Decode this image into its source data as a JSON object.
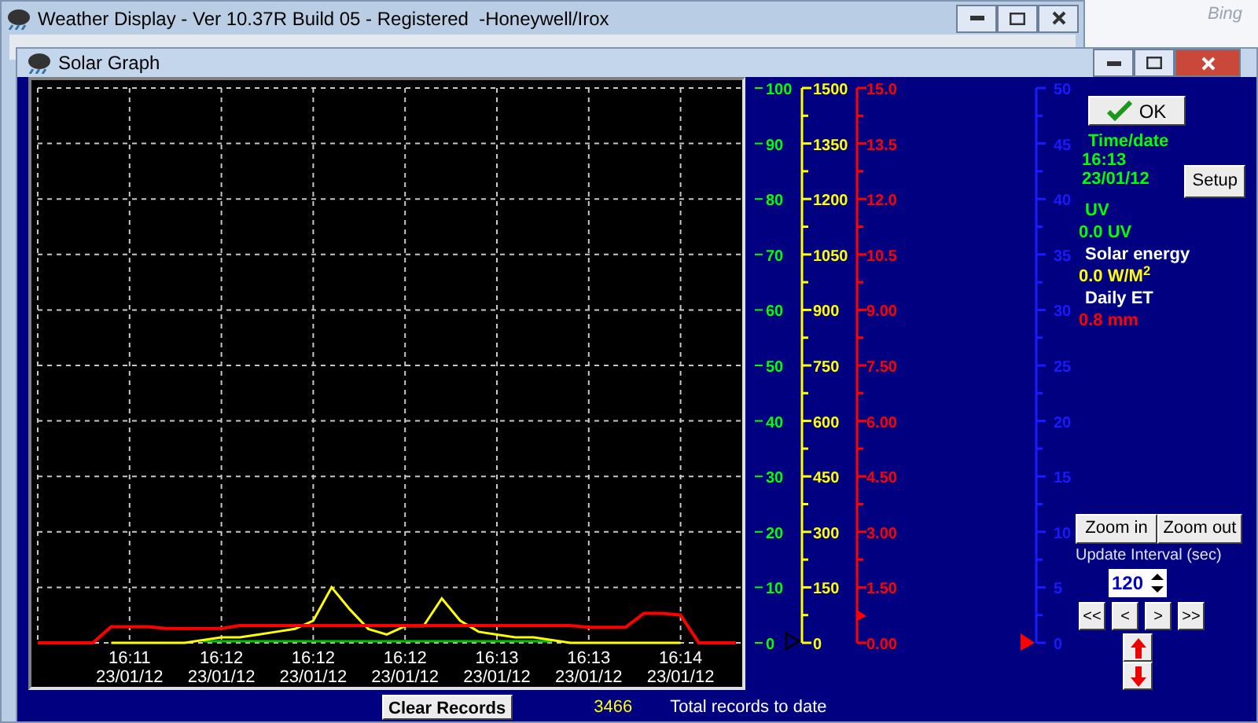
{
  "main_window": {
    "title": "Weather Display - Ver 10.37R Build 05 - Registered  -Honeywell/Irox"
  },
  "browser_behind": {
    "text": "Bing"
  },
  "solar_window": {
    "title": "Solar Graph"
  },
  "chart_data": {
    "type": "line",
    "categories": [
      null,
      null,
      null,
      null,
      null,
      "16:11\n23/01/12",
      null,
      null,
      null,
      null,
      "16:12\n23/01/12",
      null,
      null,
      null,
      null,
      "16:12\n23/01/12",
      null,
      null,
      null,
      null,
      "16:12\n23/01/12",
      null,
      null,
      null,
      null,
      "16:13\n23/01/12",
      null,
      null,
      null,
      null,
      "16:13\n23/01/12",
      null,
      null,
      null,
      null,
      "16:14\n23/01/12",
      null,
      null,
      null
    ],
    "series": [
      {
        "color": "#ff0000",
        "values": [
          0,
          0,
          0,
          0,
          2.9,
          2.9,
          2.9,
          2.6,
          2.6,
          2.6,
          2.6,
          3.1,
          3.1,
          3.1,
          3.1,
          3.1,
          3.1,
          3.1,
          3.1,
          3.1,
          3.1,
          3.1,
          3.1,
          3.1,
          3.1,
          3.1,
          3.1,
          3.1,
          3.1,
          3.1,
          2.8,
          2.8,
          2.8,
          5.3,
          5.3,
          5,
          0,
          0,
          0
        ]
      },
      {
        "color": "#ffff00",
        "values": [
          null,
          null,
          null,
          null,
          0,
          0,
          0,
          0,
          0,
          0.5,
          1,
          1,
          1.5,
          2,
          2.5,
          4,
          10,
          6,
          2.5,
          1.5,
          3,
          3,
          8,
          4,
          2,
          1.5,
          1,
          1,
          0.5,
          0,
          0,
          0,
          0,
          0,
          0,
          0,
          null,
          null,
          null
        ]
      },
      {
        "color": "#00c000",
        "values": [
          null,
          null,
          null,
          null,
          null,
          null,
          null,
          null,
          null,
          0.3,
          0.3,
          0.3,
          0.3,
          0.3,
          0.3,
          0.3,
          0.3,
          0.3,
          0.3,
          0.3,
          0.3,
          0.3,
          0.3,
          0.3,
          0.3,
          0.3,
          0.3,
          0.3,
          0.3,
          null,
          null,
          null,
          null,
          null,
          null,
          null,
          null,
          null,
          null
        ]
      }
    ],
    "ylim": [
      0,
      100
    ],
    "grid": true,
    "yticks": [
      100,
      90,
      80,
      70,
      60,
      50,
      40,
      30,
      20,
      10,
      0
    ]
  },
  "secondary_axes": [
    {
      "color": "#ffff00",
      "ticks": [
        "1500",
        "1350",
        "1200",
        "1050",
        "900",
        "750",
        "600",
        "450",
        "300",
        "150",
        "0"
      ]
    },
    {
      "color": "#ff0000",
      "ticks": [
        "15.0",
        "13.5",
        "12.0",
        "10.5",
        "9.00",
        "7.50",
        "6.00",
        "4.50",
        "3.00",
        "1.50",
        "0.00"
      ]
    },
    {
      "color": "#1a1aff",
      "ticks": [
        "50",
        "45",
        "40",
        "35",
        "30",
        "25",
        "20",
        "15",
        "10",
        "5",
        "0"
      ]
    }
  ],
  "panel": {
    "ok_button": "OK",
    "readings": [
      {
        "kind": "heading",
        "text": "Time/date",
        "color": "#00ff00"
      },
      {
        "kind": "value",
        "text": "16:13",
        "color": "#00ff00"
      },
      {
        "kind": "value",
        "text": "23/01/12",
        "color": "#00ff00"
      },
      {
        "kind": "heading",
        "text": "UV",
        "color": "#00ff00"
      },
      {
        "kind": "value",
        "text": "0.0 UV",
        "color": "#00ff00"
      },
      {
        "kind": "heading",
        "text": "Solar energy",
        "color": "#ffffff"
      },
      {
        "kind": "value",
        "text": "0.0 W/M$^{2}$",
        "color": "#ffff00"
      },
      {
        "kind": "heading",
        "text": "Daily ET",
        "color": "#ffffff"
      },
      {
        "kind": "value",
        "text": "0.8 mm",
        "color": "#ff0000"
      }
    ],
    "setup_button": "Setup",
    "zoom_in": "Zoom in",
    "zoom_out": "Zoom out",
    "interval_label": "Update Interval (sec)",
    "interval_value": "120",
    "nav_buttons": [
      "<<",
      "<",
      ">",
      ">>"
    ]
  },
  "footer": {
    "clear_button": "Clear Records",
    "count": "3466",
    "count_label": "Total records to date"
  }
}
